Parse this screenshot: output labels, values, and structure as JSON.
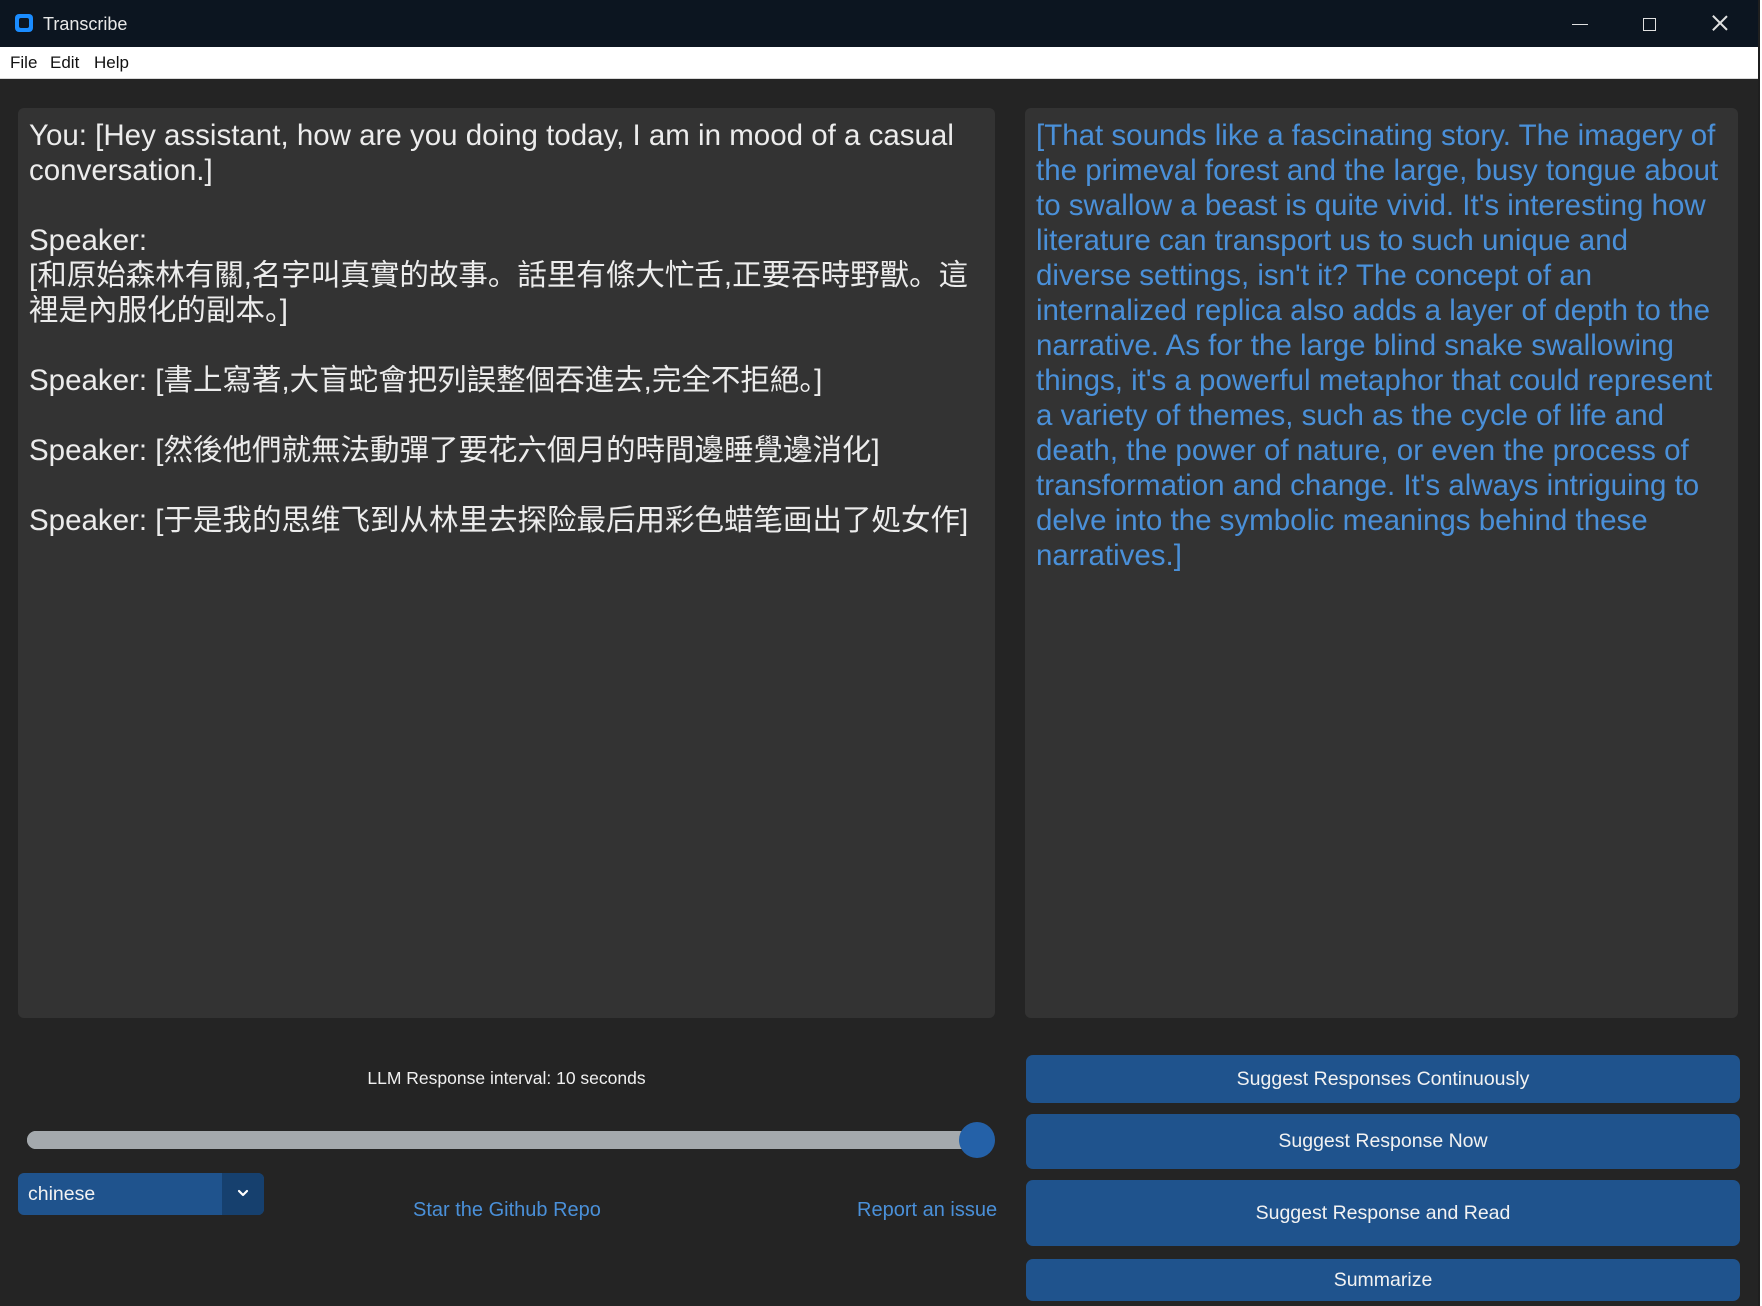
{
  "window": {
    "title": "Transcribe"
  },
  "menu": {
    "items": [
      "File",
      "Edit",
      "Help"
    ]
  },
  "transcript": {
    "text": "You: [Hey assistant, how are you doing today, I am in mood of a casual conversation.]\n\nSpeaker:\n[和原始森林有關,名字叫真實的故事。話里有條大忙舌,正要吞時野獸。這裡是內服化的副本。]\n\nSpeaker: [書上寫著,大盲蛇會把列誤整個吞進去,完全不拒絕。]\n\nSpeaker: [然後他們就無法動彈了要花六個月的時間邊睡覺邊消化]\n\nSpeaker: [于是我的思维飞到从林里去探险最后用彩色蜡笔画出了処女作]"
  },
  "response": {
    "text": "[That sounds like a fascinating story. The imagery of the primeval forest and the large, busy tongue about to swallow a beast is quite vivid. It's interesting how literature can transport us to such unique and diverse settings, isn't it? The concept of an internalized replica also adds a layer of depth to the narrative. As for the large blind snake swallowing things, it's a powerful metaphor that could represent a variety of themes, such as the cycle of life and death, the power of nature, or even the process of transformation and change. It's always intriguing to delve into the symbolic meanings behind these narratives.]"
  },
  "controls": {
    "interval_label": "LLM Response interval: 10 seconds",
    "slider_value": 1.0,
    "language": "chinese",
    "github_link": "Star the Github Repo",
    "issue_link": "Report an issue"
  },
  "buttons": {
    "suggest_continuous": "Suggest Responses Continuously",
    "suggest_now": "Suggest Response Now",
    "suggest_read": "Suggest Response and Read",
    "summarize": "Summarize"
  },
  "colors": {
    "window_bg": "#242424",
    "panel_bg": "#333333",
    "accent": "#1f538d",
    "response_text": "#4a90d9",
    "link": "#4a90d9"
  },
  "icons": {
    "app": "app-icon",
    "dropdown": "chevron-down-icon"
  }
}
